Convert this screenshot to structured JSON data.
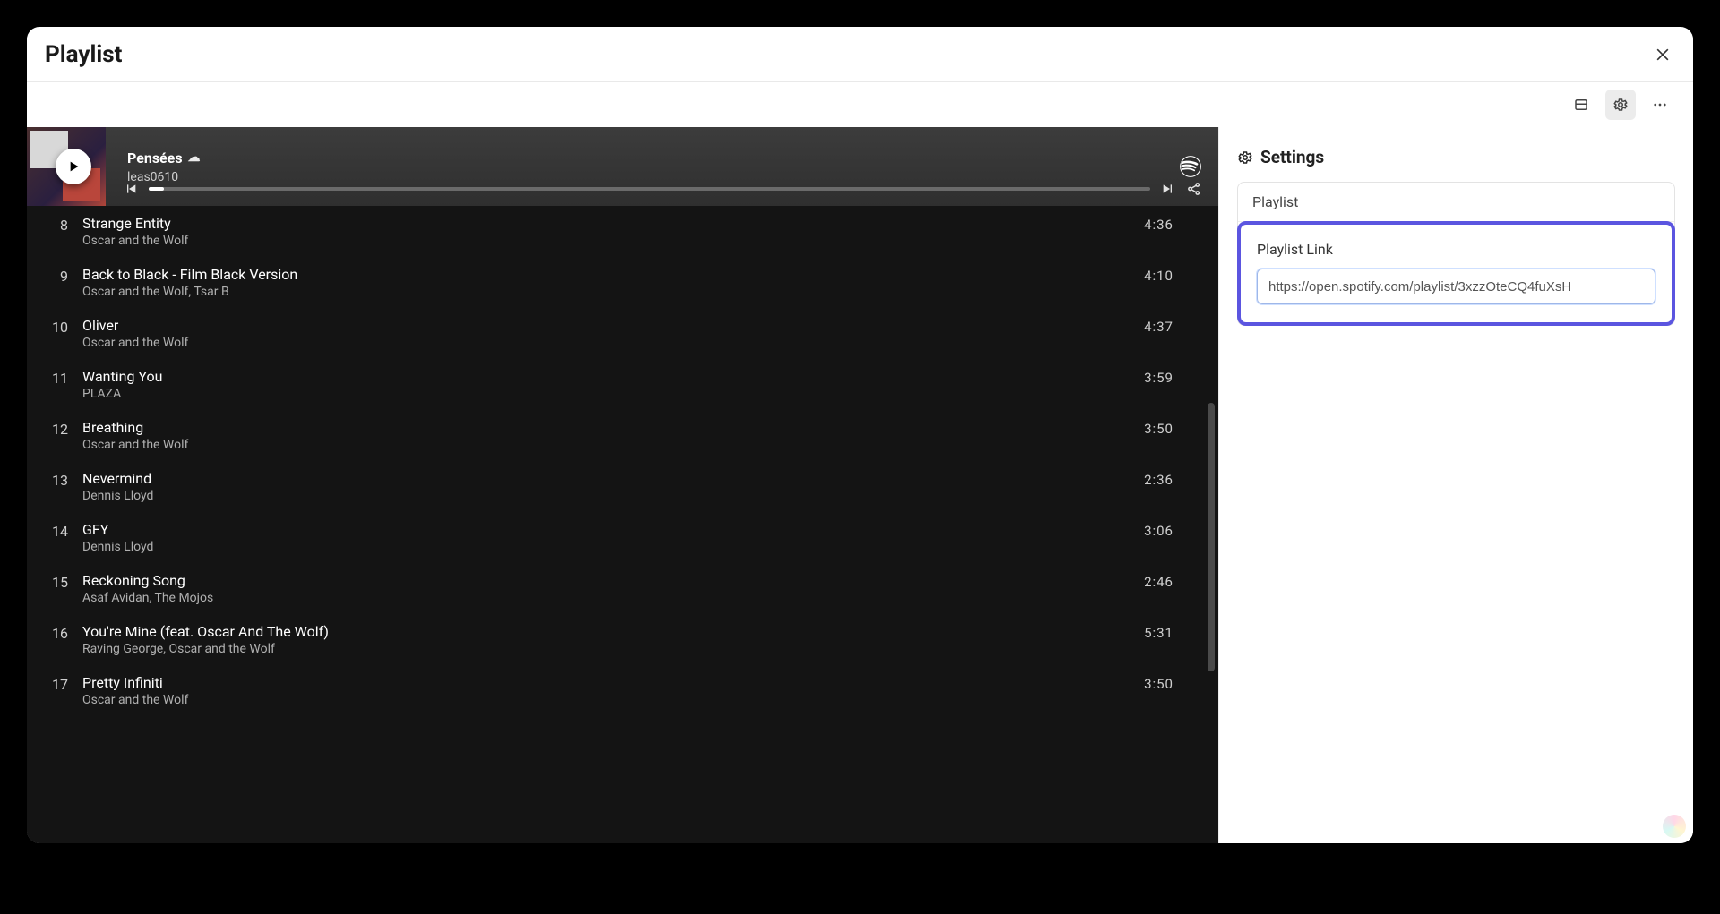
{
  "modal": {
    "title": "Playlist"
  },
  "player": {
    "playlist_title": "Pensées",
    "cloud_glyph": "☁",
    "owner": "leas0610"
  },
  "tracks": [
    {
      "num": "8",
      "title": "Strange Entity",
      "artist": "Oscar and the Wolf",
      "dur": "4:36"
    },
    {
      "num": "9",
      "title": "Back to Black - Film Black Version",
      "artist": "Oscar and the Wolf, Tsar B",
      "dur": "4:10"
    },
    {
      "num": "10",
      "title": "Oliver",
      "artist": "Oscar and the Wolf",
      "dur": "4:37"
    },
    {
      "num": "11",
      "title": "Wanting You",
      "artist": "PLAZA",
      "dur": "3:59"
    },
    {
      "num": "12",
      "title": "Breathing",
      "artist": "Oscar and the Wolf",
      "dur": "3:50"
    },
    {
      "num": "13",
      "title": "Nevermind",
      "artist": "Dennis Lloyd",
      "dur": "2:36"
    },
    {
      "num": "14",
      "title": "GFY",
      "artist": "Dennis Lloyd",
      "dur": "3:06"
    },
    {
      "num": "15",
      "title": "Reckoning Song",
      "artist": "Asaf Avidan, The Mojos",
      "dur": "2:46"
    },
    {
      "num": "16",
      "title": "You're Mine (feat. Oscar And The Wolf)",
      "artist": "Raving George, Oscar and the Wolf",
      "dur": "5:31"
    },
    {
      "num": "17",
      "title": "Pretty Infiniti",
      "artist": "Oscar and the Wolf",
      "dur": "3:50"
    }
  ],
  "settings": {
    "heading": "Settings",
    "group_label": "Playlist",
    "link_label": "Playlist Link",
    "link_value": "https://open.spotify.com/playlist/3xzzOteCQ4fuXsH"
  }
}
